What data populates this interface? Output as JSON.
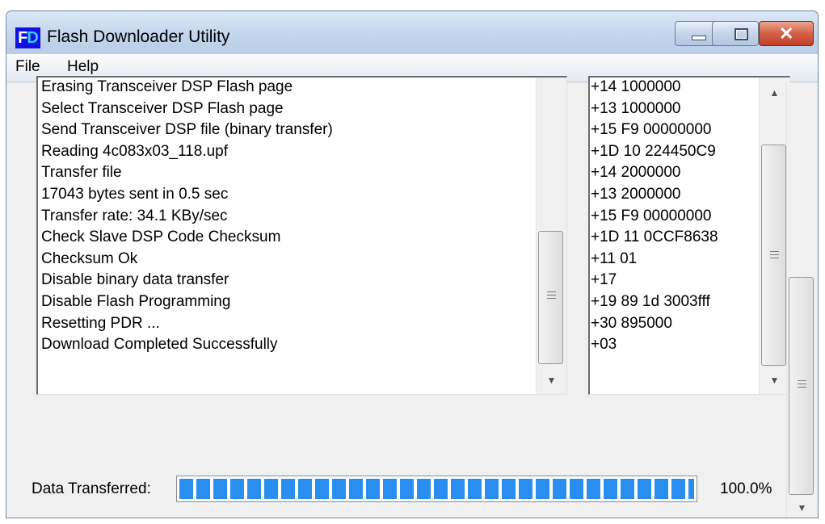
{
  "window": {
    "title": "Flash Downloader Utility",
    "icon_text": "FD"
  },
  "menu": {
    "file": "File",
    "help": "Help"
  },
  "log": {
    "lines": [
      "Erasing Transceiver DSP Flash page",
      "Select Transceiver DSP Flash page",
      "Send Transceiver DSP file (binary transfer)",
      "Reading  4c083x03_118.upf",
      "Transfer file",
      "17043 bytes sent in 0.5 sec",
      "Transfer rate: 34.1 KBy/sec",
      "Check Slave DSP Code Checksum",
      "Checksum Ok",
      "Disable binary data transfer",
      "Disable Flash Programming",
      "Resetting PDR ...",
      "Download Completed Successfully"
    ]
  },
  "commands": {
    "lines": [
      "+14 1000000",
      "+13 1000000",
      "+15 F9 00000000",
      "+1D 10 224450C9",
      "+14 2000000",
      "+13 2000000",
      "+15 F9 00000000",
      "+1D 11 0CCF8638",
      "+11 01",
      "+17",
      "+19 89 1d 3003fff",
      "+30  895000",
      "+03"
    ]
  },
  "progress": {
    "label": "Data Transferred:",
    "value": 1.0,
    "percent_text": "100.0%"
  },
  "colors": {
    "progress_fill": "#2a8ef0",
    "titlebar": "#c9daee",
    "close_button": "#d46048"
  }
}
